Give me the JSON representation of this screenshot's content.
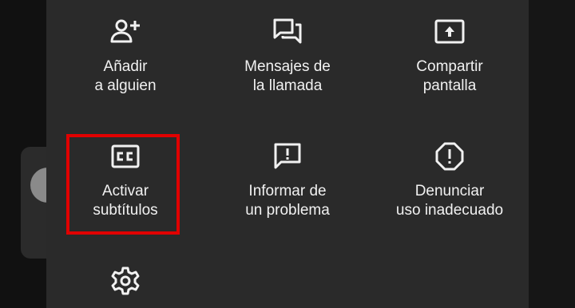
{
  "menu": {
    "items": [
      {
        "id": "add",
        "line1": "Añadir",
        "line2": "a alguien",
        "icon": "person-add-icon"
      },
      {
        "id": "messages",
        "line1": "Mensajes de",
        "line2": "la llamada",
        "icon": "chat-icon"
      },
      {
        "id": "share",
        "line1": "Compartir",
        "line2": "pantalla",
        "icon": "present-screen-icon"
      },
      {
        "id": "captions",
        "line1": "Activar",
        "line2": "subtítulos",
        "icon": "closed-captions-icon"
      },
      {
        "id": "report",
        "line1": "Informar de",
        "line2": "un problema",
        "icon": "feedback-icon"
      },
      {
        "id": "abuse",
        "line1": "Denunciar",
        "line2": "uso inadecuado",
        "icon": "report-octagon-icon"
      },
      {
        "id": "settings",
        "line1": "",
        "line2": "",
        "icon": "gear-icon"
      }
    ]
  },
  "colors": {
    "sheet": "#2a2a2a",
    "text": "#f1f1f1",
    "highlight": "#e10000"
  }
}
